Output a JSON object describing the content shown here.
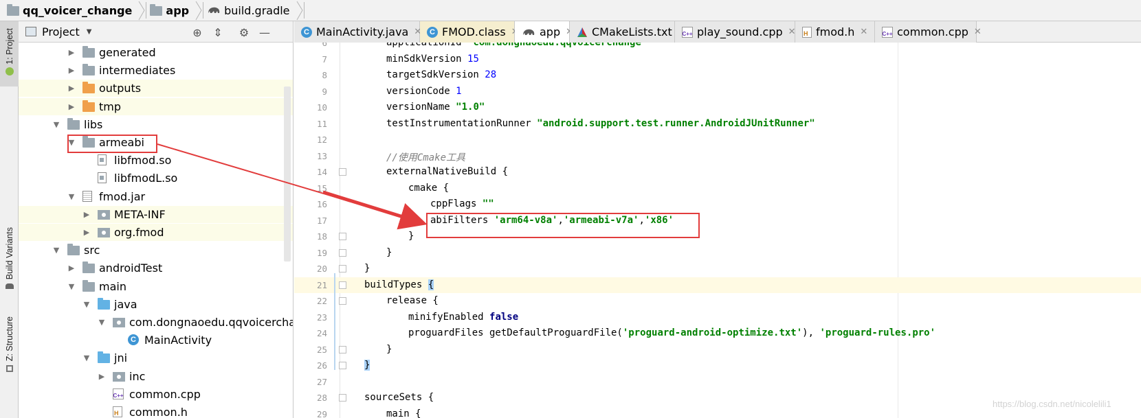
{
  "breadcrumb": {
    "items": [
      {
        "label": "qq_voicer_change",
        "icon": "folder-icon"
      },
      {
        "label": "app",
        "icon": "module-folder-icon"
      },
      {
        "label": "build.gradle",
        "icon": "gradle-elephant-icon"
      }
    ]
  },
  "left_strip": {
    "project_label": "1: Project",
    "build_variants_label": "Build Variants",
    "structure_label": "Z: Structure"
  },
  "project_panel": {
    "title": "Project",
    "dropdown_icon": "chevron-down-icon",
    "buttons": [
      "locate-icon",
      "collapse-all-icon",
      "gear-icon",
      "minimize-icon"
    ]
  },
  "tree": [
    {
      "label": "generated",
      "icon": "folder",
      "depth": 3,
      "arrow": "collapsed",
      "highlight": false
    },
    {
      "label": "intermediates",
      "icon": "folder",
      "depth": 3,
      "arrow": "collapsed",
      "highlight": false
    },
    {
      "label": "outputs",
      "icon": "folder-orange",
      "depth": 3,
      "arrow": "collapsed",
      "highlight": true
    },
    {
      "label": "tmp",
      "icon": "folder-orange",
      "depth": 3,
      "arrow": "collapsed",
      "highlight": true
    },
    {
      "label": "libs",
      "icon": "folder",
      "depth": 2,
      "arrow": "expanded",
      "highlight": false
    },
    {
      "label": "armeabi",
      "icon": "folder",
      "depth": 3,
      "arrow": "expanded",
      "highlight": false
    },
    {
      "label": "libfmod.so",
      "icon": "file",
      "depth": 4,
      "arrow": "none",
      "highlight": false
    },
    {
      "label": "libfmodL.so",
      "icon": "file",
      "depth": 4,
      "arrow": "none",
      "highlight": false
    },
    {
      "label": "fmod.jar",
      "icon": "jar",
      "depth": 3,
      "arrow": "expanded",
      "highlight": false
    },
    {
      "label": "META-INF",
      "icon": "package",
      "depth": 4,
      "arrow": "collapsed",
      "highlight": true
    },
    {
      "label": "org.fmod",
      "icon": "package",
      "depth": 4,
      "arrow": "collapsed",
      "highlight": true
    },
    {
      "label": "src",
      "icon": "folder",
      "depth": 2,
      "arrow": "expanded",
      "highlight": false
    },
    {
      "label": "androidTest",
      "icon": "folder",
      "depth": 3,
      "arrow": "collapsed",
      "highlight": false
    },
    {
      "label": "main",
      "icon": "folder",
      "depth": 3,
      "arrow": "expanded",
      "highlight": false
    },
    {
      "label": "java",
      "icon": "folder-blue",
      "depth": 4,
      "arrow": "expanded",
      "highlight": false
    },
    {
      "label": "com.dongnaoedu.qqvoicerchang",
      "icon": "package",
      "depth": 5,
      "arrow": "expanded",
      "highlight": false
    },
    {
      "label": "MainActivity",
      "icon": "class",
      "depth": 6,
      "arrow": "none",
      "highlight": false
    },
    {
      "label": "jni",
      "icon": "folder-blue",
      "depth": 4,
      "arrow": "expanded",
      "highlight": false
    },
    {
      "label": "inc",
      "icon": "package",
      "depth": 5,
      "arrow": "collapsed",
      "highlight": false
    },
    {
      "label": "common.cpp",
      "icon": "cpp",
      "depth": 5,
      "arrow": "none",
      "highlight": false
    },
    {
      "label": "common.h",
      "icon": "h",
      "depth": 5,
      "arrow": "none",
      "highlight": false
    }
  ],
  "tabs": [
    {
      "label": "MainActivity.java",
      "icon": "class",
      "state": "normal"
    },
    {
      "label": "FMOD.class",
      "icon": "class",
      "state": "modified"
    },
    {
      "label": "app",
      "icon": "gradle",
      "state": "active"
    },
    {
      "label": "CMakeLists.txt",
      "icon": "cmake",
      "state": "normal"
    },
    {
      "label": "play_sound.cpp",
      "icon": "cpp",
      "state": "normal"
    },
    {
      "label": "fmod.h",
      "icon": "h",
      "state": "normal"
    },
    {
      "label": "common.cpp",
      "icon": "cpp",
      "state": "normal"
    }
  ],
  "tab_close_glyph": "✕",
  "editor": {
    "lines": [
      {
        "n": "6",
        "code": "applicationId \"com.dongnaoedu.qqvoicerchange\""
      },
      {
        "n": "7",
        "code": "minSdkVersion 15"
      },
      {
        "n": "8",
        "code": "targetSdkVersion 28"
      },
      {
        "n": "9",
        "code": "versionCode 1"
      },
      {
        "n": "10",
        "code": "versionName \"1.0\""
      },
      {
        "n": "11",
        "code": "testInstrumentationRunner \"android.support.test.runner.AndroidJUnitRunner\""
      },
      {
        "n": "12",
        "code": ""
      },
      {
        "n": "13",
        "code": "//使用Cmake工具"
      },
      {
        "n": "14",
        "code": "externalNativeBuild {"
      },
      {
        "n": "15",
        "code": "cmake {"
      },
      {
        "n": "16",
        "code": "cppFlags \"\""
      },
      {
        "n": "17",
        "code": "abiFilters 'arm64-v8a','armeabi-v7a','x86'"
      },
      {
        "n": "18",
        "code": "}"
      },
      {
        "n": "19",
        "code": "}"
      },
      {
        "n": "20",
        "code": "}"
      },
      {
        "n": "21",
        "code": "buildTypes {"
      },
      {
        "n": "22",
        "code": "release {"
      },
      {
        "n": "23",
        "code": "minifyEnabled false"
      },
      {
        "n": "24",
        "code": "proguardFiles getDefaultProguardFile('proguard-android-optimize.txt'), 'proguard-rules.pro'"
      },
      {
        "n": "25",
        "code": "}"
      },
      {
        "n": "26",
        "code": "}"
      },
      {
        "n": "27",
        "code": ""
      },
      {
        "n": "28",
        "code": "sourceSets {"
      },
      {
        "n": "29",
        "code": "main {"
      }
    ],
    "current_line": "21"
  },
  "watermark": "https://blog.csdn.net/nicolelili1",
  "colors": {
    "annotation_red": "#e23c3c",
    "string_green": "#008000",
    "number_blue": "#0000ff",
    "keyword_navy": "#000080"
  }
}
